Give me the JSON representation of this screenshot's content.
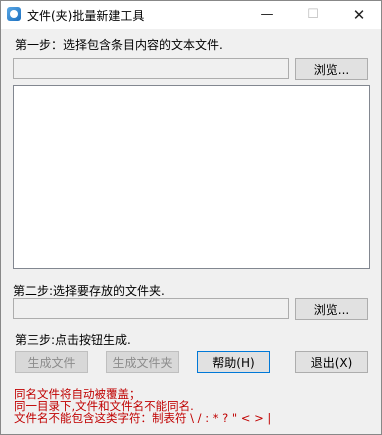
{
  "window": {
    "title": "文件(夹)批量新建工具",
    "min_symbol": "—",
    "max_symbol": "☐",
    "close_symbol": "✕"
  },
  "step1": {
    "label": "第一步：选择包含条目内容的文本文件.",
    "path_value": "",
    "browse_label": "浏览..."
  },
  "content_list": [],
  "step2": {
    "label": "第二步:选择要存放的文件夹.",
    "path_value": "",
    "browse_label": "浏览..."
  },
  "step3": {
    "label": "第三步:点击按钮生成."
  },
  "buttons": {
    "gen_files": "生成文件",
    "gen_folders": "生成文件夹",
    "help": "帮助(H)",
    "exit": "退出(X)"
  },
  "notes": [
    "同名文件将自动被覆盖；",
    "同一目录下,文件和文件名不能同名.",
    "文件名不能包含这类字符：制表符  \\ / : * ? \" < > |"
  ],
  "colors": {
    "note_text": "#c00000",
    "window_bg": "#f0f0f0",
    "accent": "#0078d7"
  }
}
